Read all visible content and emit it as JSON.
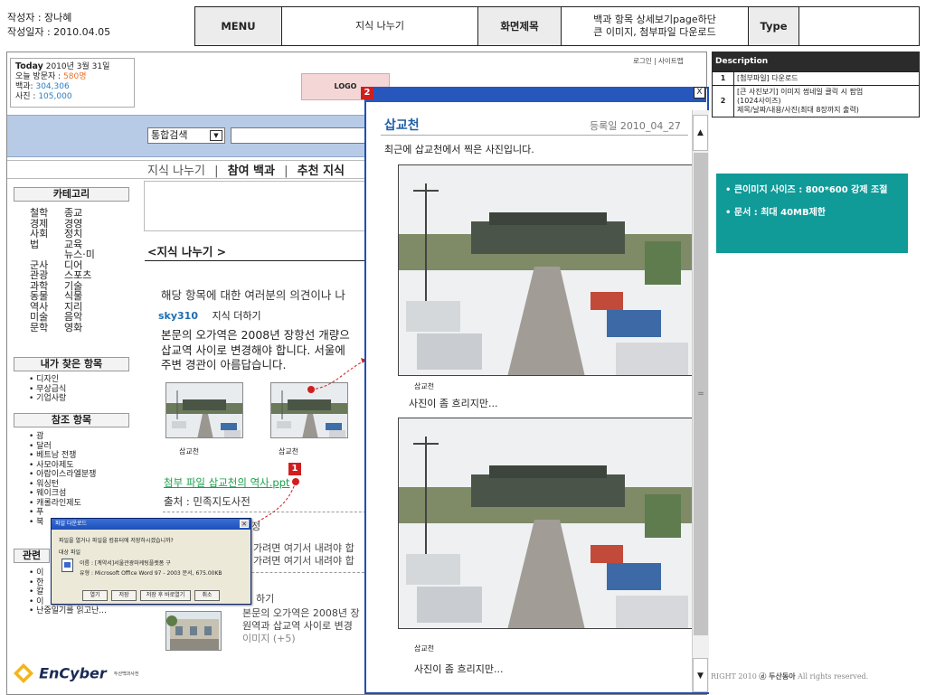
{
  "storyboard": {
    "author_line": "작성자 : 장나혜",
    "date_line": "작성일자 : 2010.04.05",
    "menu_label": "MENU",
    "menu_value": "지식 나누기",
    "screen_title_label": "화면제목",
    "screen_title_line1": "백과 항목 상세보기page하단",
    "screen_title_line2": "큰 이미지, 첨부파일 다운로드",
    "type_label": "Type",
    "type_value": ""
  },
  "site": {
    "today_label": "Today",
    "today_date": "2010년 3월 31일",
    "visitors_label": "오늘 방문자 : ",
    "visitors_value": "580명",
    "encyclopedia_label": "백과: ",
    "encyclopedia_value": "304,306",
    "photos_label": "사진 : ",
    "photos_value": "105,000",
    "logo_text": "LOGO",
    "top_nav": "로그인 | 사이트맵",
    "search_select": "통합검색",
    "search_dropdown_glyph": "▼",
    "menu_item1": "지식 나누기",
    "menu_sep": "|",
    "menu_item2": "참여 백과",
    "menu_item3": "추천 지식"
  },
  "sidebar": {
    "category_header": "카테고리",
    "category_rows": [
      [
        "철학",
        "종교"
      ],
      [
        "경제",
        "경영"
      ],
      [
        "사회",
        "정치"
      ],
      [
        "법",
        "교육"
      ],
      [
        "군사",
        "뉴스·미디어"
      ],
      [
        "관광",
        "스포츠"
      ],
      [
        "과학",
        "기술"
      ],
      [
        "동물",
        "식물"
      ],
      [
        "역사",
        "지리"
      ],
      [
        "미술",
        "음악"
      ],
      [
        "문학",
        "영화"
      ]
    ],
    "found_header": "내가 찾은 항목",
    "found_items": [
      "디자인",
      "무상급식",
      "기업사랑"
    ],
    "ref_header": "참조 항목",
    "ref_items": [
      "괌",
      "달러",
      "베트남 전쟁",
      "사모아제도",
      "아랍이스라엘분쟁",
      "워싱턴",
      "웨이크섬",
      "캐롤라인제도",
      "푸",
      "북"
    ],
    "related_header_partial": "관련",
    "related_items": [
      "이",
      "한",
      "칼",
      "이",
      "난중일기를 읽고난..."
    ]
  },
  "main": {
    "sub_title": "<지식 나누기 >",
    "intro": "해당 항목에 대한 여러분의 의견이나 나",
    "user": "sky310",
    "user_action": "지식 더하기",
    "body_line1": "본문의 오가역은 2008년 장항선 개량으",
    "body_line2": "삽교역 사이로 변경해야 합니다. 서울에",
    "body_line3": "주변 경관이 아름답습니다.",
    "thumb_caption1": "삽교천",
    "thumb_caption2": "삽교천",
    "attach_link": "첨부 파일 삽교천의 역사.ppt",
    "source": "출처 : 민족지도사전",
    "frag_jeong": "정",
    "frag_line1": "가려면 여기서 내려야 합",
    "frag_line2": "가려면 여기서 내려야 합",
    "frag_hagi": "하기",
    "lower_line1": "본문의 오가역은 2008년 장",
    "lower_line2": "원역과 삽교역 사이로 변경",
    "lower_images": "이미지 (+5)"
  },
  "download_dialog": {
    "title": "파일 다운로드",
    "question": "파일을 열거나 파일을 컴퓨터에 저장하시겠습니까?",
    "target_label": "대상 파일",
    "file_name": "이름 : [계약서]서울관광마케팅플랫폼 구",
    "file_type": "유형 : Microsoft Office Word 97 - 2003 문서, 675.00KB",
    "btn_open": "열기",
    "btn_save": "저장",
    "btn_save_open": "저장 후 바로열기",
    "btn_cancel": "취소"
  },
  "popup": {
    "marker": "2",
    "close": "X",
    "title": "삽교천",
    "date": "등록일 2010_04_27",
    "description": "최근에 삽교천에서 찍은 사진입니다.",
    "photo1_caption": "삽교천",
    "photo1_text": "사진이 좀 흐리지만...",
    "photo2_caption": "삽교천",
    "photo2_text": "사진이 좀 흐리지만...",
    "scroll_up": "▲",
    "scroll_grip": "=",
    "scroll_down": "▼"
  },
  "marker1": "1",
  "footer": {
    "logo": "EnCyber",
    "logo_sub": "두산백과사전",
    "copyright_prefix": "RIGHT 2010 ",
    "copyright_brand": "ⓓ 두산동아",
    "copyright_suffix": " All rights reserved."
  },
  "description": {
    "header": "Description",
    "rows": [
      {
        "num": "1",
        "text": "[첨부파일] 다운로드"
      },
      {
        "num": "2",
        "text_line1": "[큰 사진보기] 이미지 썸네일 클릭 시 팝업",
        "text_line2": "(1024사이즈)",
        "text_line3": "제목/날짜/내용/사진(최대 8장까지 출력)"
      }
    ],
    "note1": "• 큰이미지 사이즈 : 800*600 강제 조절",
    "note2": "• 문서 : 최대 40MB제한"
  },
  "colors": {
    "popup_border": "#1f4fb3",
    "marker_red": "#d01e1e",
    "teal": "#109a98",
    "link_green": "#19a04a"
  }
}
